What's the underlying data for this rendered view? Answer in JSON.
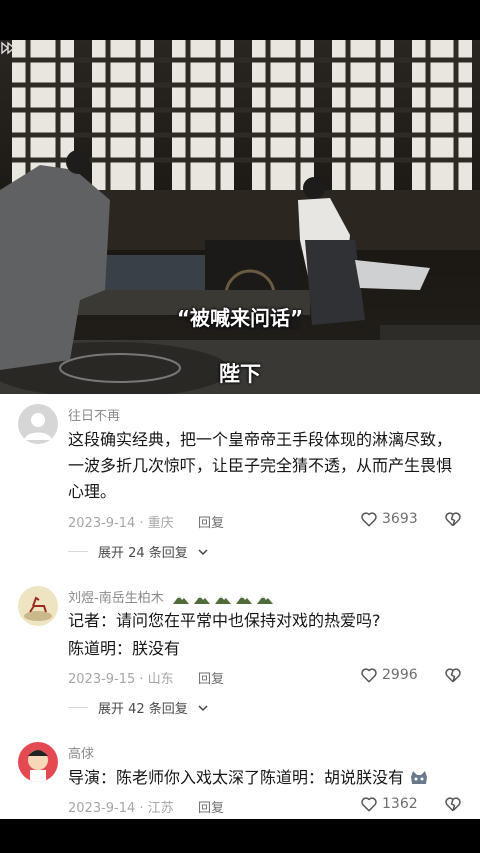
{
  "video": {
    "caption_top": "“被喊来问话”",
    "caption_bottom": "陛下"
  },
  "comments": [
    {
      "username": "往日不再",
      "text": "这段确实经典，把一个皇帝帝王手段体现的淋漓尽致，一波多折几次惊吓，让臣子完全猜不透，从而产生畏惧心理。",
      "date_location": "2023-9-14 · 重庆",
      "reply_label": "回复",
      "likes": "3693",
      "expand_label": "展开 24 条回复"
    },
    {
      "username": "刘煜-南岳生柏木",
      "text_line1": "记者：请问您在平常中也保持对戏的热爱吗?",
      "text_line2": "陈道明：朕没有",
      "date_location": "2023-9-15 · 山东",
      "reply_label": "回复",
      "likes": "2996",
      "expand_label": "展开 42 条回复"
    },
    {
      "username": "高俅",
      "text": "导演：陈老师你入戏太深了陈道明：胡说朕没有",
      "date_location": "2023-9-14 · 江苏",
      "reply_label": "回复",
      "likes": "1362"
    }
  ],
  "icons": {
    "like": "heart-outline-icon",
    "dislike": "broken-heart-icon",
    "expand": "chevron-down-icon"
  }
}
